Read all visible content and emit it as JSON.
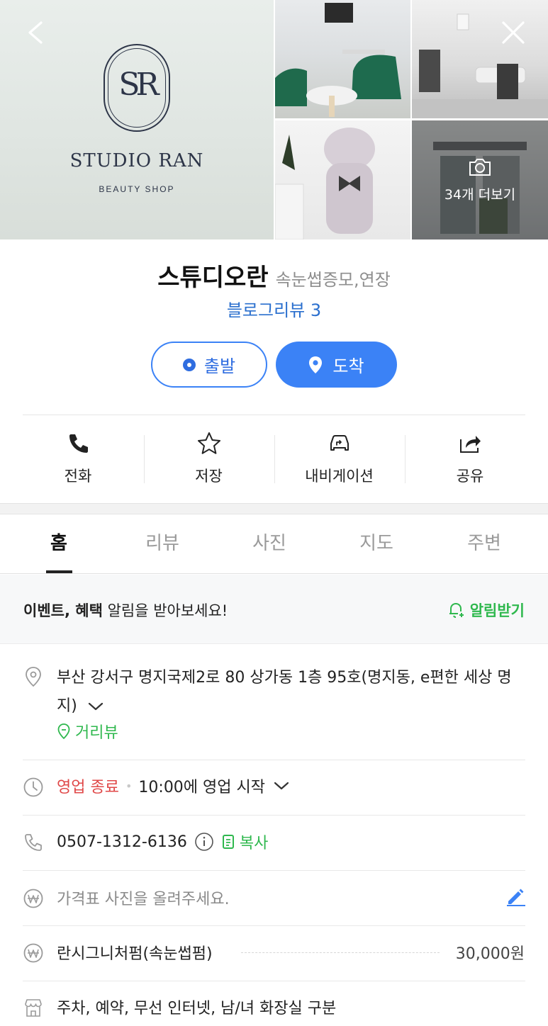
{
  "gallery": {
    "logo_monogram": "SR",
    "logo_name": "STUDIO RAN",
    "logo_sub": "BEAUTY SHOP",
    "more_photos_label": "34개 더보기",
    "icons": [
      "back-arrow-icon",
      "close-icon",
      "camera-icon"
    ]
  },
  "place": {
    "name": "스튜디오란",
    "category": "속눈썹증모,연장",
    "blog_review": "블로그리뷰 3"
  },
  "route": {
    "depart_label": "출발",
    "arrive_label": "도착"
  },
  "actions": [
    {
      "label": "전화",
      "icon": "phone-icon"
    },
    {
      "label": "저장",
      "icon": "star-icon"
    },
    {
      "label": "내비게이션",
      "icon": "car-navigation-icon"
    },
    {
      "label": "공유",
      "icon": "share-icon"
    }
  ],
  "tabs": [
    {
      "label": "홈",
      "active": true
    },
    {
      "label": "리뷰",
      "active": false
    },
    {
      "label": "사진",
      "active": false
    },
    {
      "label": "지도",
      "active": false
    },
    {
      "label": "주변",
      "active": false
    }
  ],
  "notice": {
    "bold_text": "이벤트, 혜택",
    "text": " 알림을 받아보세요!",
    "alert_label": "알림받기"
  },
  "info": {
    "address": "부산 강서구 명지국제2로 80 상가동 1층 95호(명지동, e편한 세상 명지)",
    "street_view": "거리뷰",
    "status": "영업 종료",
    "opening": "10:00에 영업 시작",
    "phone": "0507-1312-6136",
    "copy_label": "복사",
    "price_prompt": "가격표 사진을 올려주세요.",
    "price_item_name": "란시그니처펌(속눈썹펌)",
    "price_item_value": "30,000원",
    "amenities": "주차, 예약, 무선 인터넷, 남/녀 화장실 구분"
  },
  "colors": {
    "accent_blue": "#3b82f6",
    "link_blue": "#2a6fce",
    "green": "#2fb84e",
    "closed_red": "#e04848"
  }
}
